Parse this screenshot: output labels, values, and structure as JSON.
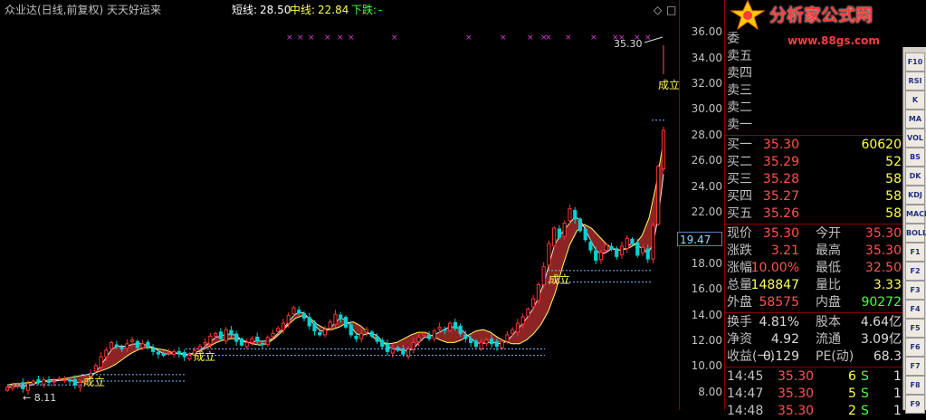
{
  "header": {
    "title": "众业达(日线,前复权) 天天好运来",
    "short_label": "短线:",
    "short_value": "28.50",
    "mid_label": "中线:",
    "mid_value": "22.84",
    "trend_label": "下跌:",
    "trend_value": "-"
  },
  "window_controls": {
    "restore": "◇",
    "maximize": "□"
  },
  "axis": {
    "ticks": [
      "36.00",
      "34.00",
      "32.00",
      "30.00",
      "28.00",
      "26.00",
      "24.00",
      "22.00",
      "20.00",
      "18.00",
      "16.00",
      "14.00",
      "12.00",
      "10.00",
      "8.00"
    ],
    "ymin": 7.0,
    "ymax": 37.0,
    "current_marker": "19.47"
  },
  "annotations": {
    "high_price": "35.30",
    "low_price": "8.11",
    "signal_top": "成立",
    "signal_labels": [
      "成立",
      "成立",
      "成立"
    ]
  },
  "chart_data": {
    "type": "candlestick",
    "title": "众业达(日线,前复权) 天天好运来",
    "ylim": [
      7.0,
      37.0
    ],
    "closes": [
      8.4,
      8.5,
      8.6,
      8.3,
      8.7,
      8.9,
      8.8,
      9.0,
      8.8,
      8.9,
      9.1,
      9.0,
      8.9,
      8.6,
      8.8,
      9.2,
      9.5,
      10.1,
      10.8,
      11.3,
      11.9,
      11.6,
      11.4,
      11.8,
      12.1,
      11.5,
      11.8,
      11.6,
      11.2,
      11.0,
      10.9,
      11.1,
      11.2,
      11.0,
      10.8,
      11.0,
      11.3,
      11.6,
      11.9,
      12.4,
      12.6,
      12.2,
      12.9,
      12.5,
      12.0,
      11.7,
      11.9,
      12.2,
      12.0,
      11.8,
      12.3,
      12.6,
      13.0,
      13.4,
      14.0,
      14.6,
      14.2,
      13.8,
      13.2,
      12.8,
      12.5,
      12.9,
      13.5,
      14.1,
      13.8,
      13.1,
      12.5,
      12.2,
      12.6,
      12.9,
      12.4,
      12.0,
      11.6,
      11.2,
      11.5,
      11.3,
      11.0,
      11.4,
      11.9,
      12.3,
      12.6,
      12.2,
      12.8,
      13.1,
      12.9,
      13.4,
      13.0,
      12.6,
      12.2,
      11.9,
      11.6,
      11.9,
      12.1,
      11.8,
      11.6,
      12.0,
      12.5,
      12.9,
      13.4,
      13.9,
      14.5,
      15.3,
      16.4,
      17.8,
      19.6,
      20.8,
      20.1,
      21.2,
      22.3,
      21.5,
      20.6,
      19.9,
      19.1,
      18.3,
      18.9,
      19.5,
      19.2,
      18.6,
      19.4,
      20.0,
      19.6,
      18.7,
      19.3,
      18.4,
      21.0,
      25.6,
      28.4
    ],
    "mid_line": [
      8.6,
      8.7,
      8.7,
      8.8,
      8.8,
      8.9,
      9.0,
      9.0,
      9.1,
      9.2,
      9.3,
      9.4,
      9.5,
      9.7,
      9.9,
      10.2,
      10.6,
      11.0,
      11.3,
      11.5,
      11.5,
      11.4,
      11.3,
      11.1,
      11.0,
      11.0,
      11.1,
      11.3,
      11.6,
      11.9,
      12.1,
      12.2,
      12.2,
      12.0,
      11.8,
      11.7,
      11.8,
      12.2,
      12.7,
      13.3,
      13.8,
      14.0,
      13.8,
      13.3,
      13.0,
      12.9,
      13.1,
      13.4,
      13.5,
      13.2,
      12.7,
      12.2,
      11.9,
      11.8,
      11.9,
      12.2,
      12.5,
      12.7,
      12.7,
      12.4,
      12.1,
      11.9,
      11.9,
      12.1,
      12.5,
      12.8,
      12.9,
      12.7,
      12.3,
      12.0,
      11.8,
      11.8,
      12.1,
      12.6,
      13.3,
      14.3,
      15.8,
      17.8,
      19.5,
      20.6,
      21.1,
      20.8,
      20.2,
      19.6,
      19.2,
      19.1,
      19.2,
      19.5,
      20.2,
      21.6,
      24.2,
      27.6
    ]
  },
  "quote": {
    "wei": {
      "label": "委",
      "value": ""
    },
    "asks": [
      {
        "label": "卖五",
        "price": "",
        "vol": ""
      },
      {
        "label": "卖四",
        "price": "",
        "vol": ""
      },
      {
        "label": "卖三",
        "price": "",
        "vol": ""
      },
      {
        "label": "卖二",
        "price": "",
        "vol": ""
      },
      {
        "label": "卖一",
        "price": "",
        "vol": ""
      }
    ],
    "bids": [
      {
        "label": "买一",
        "price": "35.30",
        "vol": "60620"
      },
      {
        "label": "买二",
        "price": "35.29",
        "vol": "52"
      },
      {
        "label": "买三",
        "price": "35.28",
        "vol": "58"
      },
      {
        "label": "买四",
        "price": "35.27",
        "vol": "58"
      },
      {
        "label": "买五",
        "price": "35.26",
        "vol": "58"
      }
    ],
    "stats": [
      {
        "l1": "现价",
        "v1": "35.30",
        "l2": "今开",
        "v2": "35.30"
      },
      {
        "l1": "涨跌",
        "v1": "3.21",
        "l2": "最高",
        "v2": "35.30"
      },
      {
        "l1": "涨幅",
        "v1": "10.00%",
        "l2": "最低",
        "v2": "32.50"
      },
      {
        "l1": "总量",
        "v1": "148847",
        "l2": "量比",
        "v2": "3.33"
      },
      {
        "l1": "外盘",
        "v1": "58575",
        "l2": "内盘",
        "v2": "90272"
      }
    ],
    "finance": [
      {
        "l1": "换手",
        "v1": "4.81%",
        "l2": "股本",
        "v2": "4.64亿"
      },
      {
        "l1": "净资",
        "v1": "4.92",
        "l2": "流通",
        "v2": "3.09亿"
      },
      {
        "l1": "收益(一)",
        "v1": "0.129",
        "l2": "PE(动)",
        "v2": "68.3"
      }
    ],
    "ticks": [
      {
        "time": "14:45",
        "price": "35.30",
        "vol": "6",
        "side": "S",
        "n": "1"
      },
      {
        "time": "14:47",
        "price": "35.30",
        "vol": "5",
        "side": "S",
        "n": "1"
      },
      {
        "time": "14:48",
        "price": "35.30",
        "vol": "2",
        "side": "S",
        "n": "1"
      }
    ]
  },
  "logo": {
    "brand": "分析家公式网",
    "url": "www.88gs.com"
  },
  "toolbar": [
    "F10",
    "RSI",
    "K",
    "MA",
    "VOL",
    "BS",
    "DK",
    "KDJ",
    "MACD",
    "BOLL",
    "F1",
    "F2",
    "F3",
    "F4",
    "F5",
    "F6",
    "F7",
    "F8",
    "F9"
  ],
  "colors": {
    "up": "#ff3232",
    "down": "#00d2d2",
    "band": "#a52a2a",
    "mid_line": "#ffff66",
    "accent": "#ff3b3b"
  }
}
